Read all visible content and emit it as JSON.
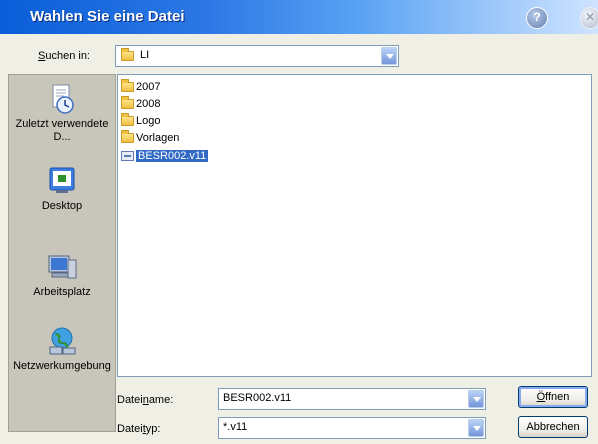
{
  "window": {
    "title": "Wahlen Sie eine Datei"
  },
  "lookin": {
    "label_pre": "",
    "label_u": "S",
    "label_post": "uchen in:",
    "value": "LI"
  },
  "places": [
    {
      "label": "Zuletzt verwendete D...",
      "icon": "recent-documents-icon"
    },
    {
      "label": "Desktop",
      "icon": "desktop-icon"
    },
    {
      "label": "Arbeitsplatz",
      "icon": "my-computer-icon"
    },
    {
      "label": "Netzwerkumgebung",
      "icon": "network-places-icon"
    }
  ],
  "files": [
    {
      "name": "2007",
      "type": "folder"
    },
    {
      "name": "2008",
      "type": "folder"
    },
    {
      "name": "Logo",
      "type": "folder"
    },
    {
      "name": "Vorlagen",
      "type": "folder"
    },
    {
      "name": "BESR002.v11",
      "type": "file",
      "selected": true
    }
  ],
  "filename": {
    "label_pre": "Datei",
    "label_u": "n",
    "label_post": "ame:",
    "value": "BESR002.v11"
  },
  "filetype": {
    "label_pre": "Datei",
    "label_u": "t",
    "label_post": "yp:",
    "value": "*.v11"
  },
  "buttons": {
    "open_u": "Ö",
    "open_rest": "ffnen",
    "cancel": "Abbrechen"
  },
  "colors": {
    "title_bar": "#0a5ed8",
    "selection": "#316ac5",
    "dialog_bg": "#f0efe6"
  }
}
